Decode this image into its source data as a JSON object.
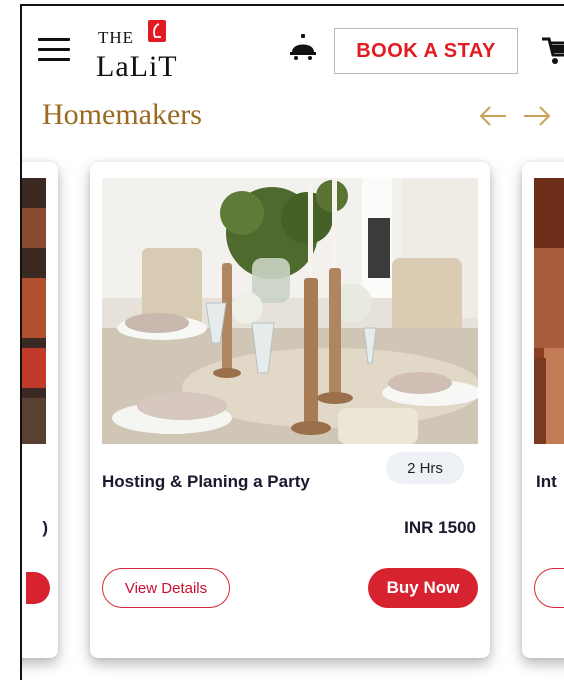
{
  "header": {
    "logo_top": "THE",
    "logo_name": "LaLiT",
    "book_label": "BOOK A STAY",
    "icons": {
      "menu": "hamburger-menu-icon",
      "bell": "room-service-bell-icon",
      "cart": "shopping-cart-icon"
    }
  },
  "section": {
    "title": "Homemakers",
    "prev_icon": "arrow-left-icon",
    "next_icon": "arrow-right-icon"
  },
  "cards": {
    "main": {
      "title": "Hosting & Planing a Party",
      "duration": "2 Hrs",
      "price": "INR 1500",
      "details_label": "View Details",
      "buy_label": "Buy Now"
    },
    "left_peek": {
      "price_fragment": ")"
    },
    "right_peek": {
      "title_fragment": "Int"
    }
  },
  "colors": {
    "brand_red": "#d7232f",
    "title_gold": "#9a6a22",
    "text_dark": "#1a1a2e"
  }
}
